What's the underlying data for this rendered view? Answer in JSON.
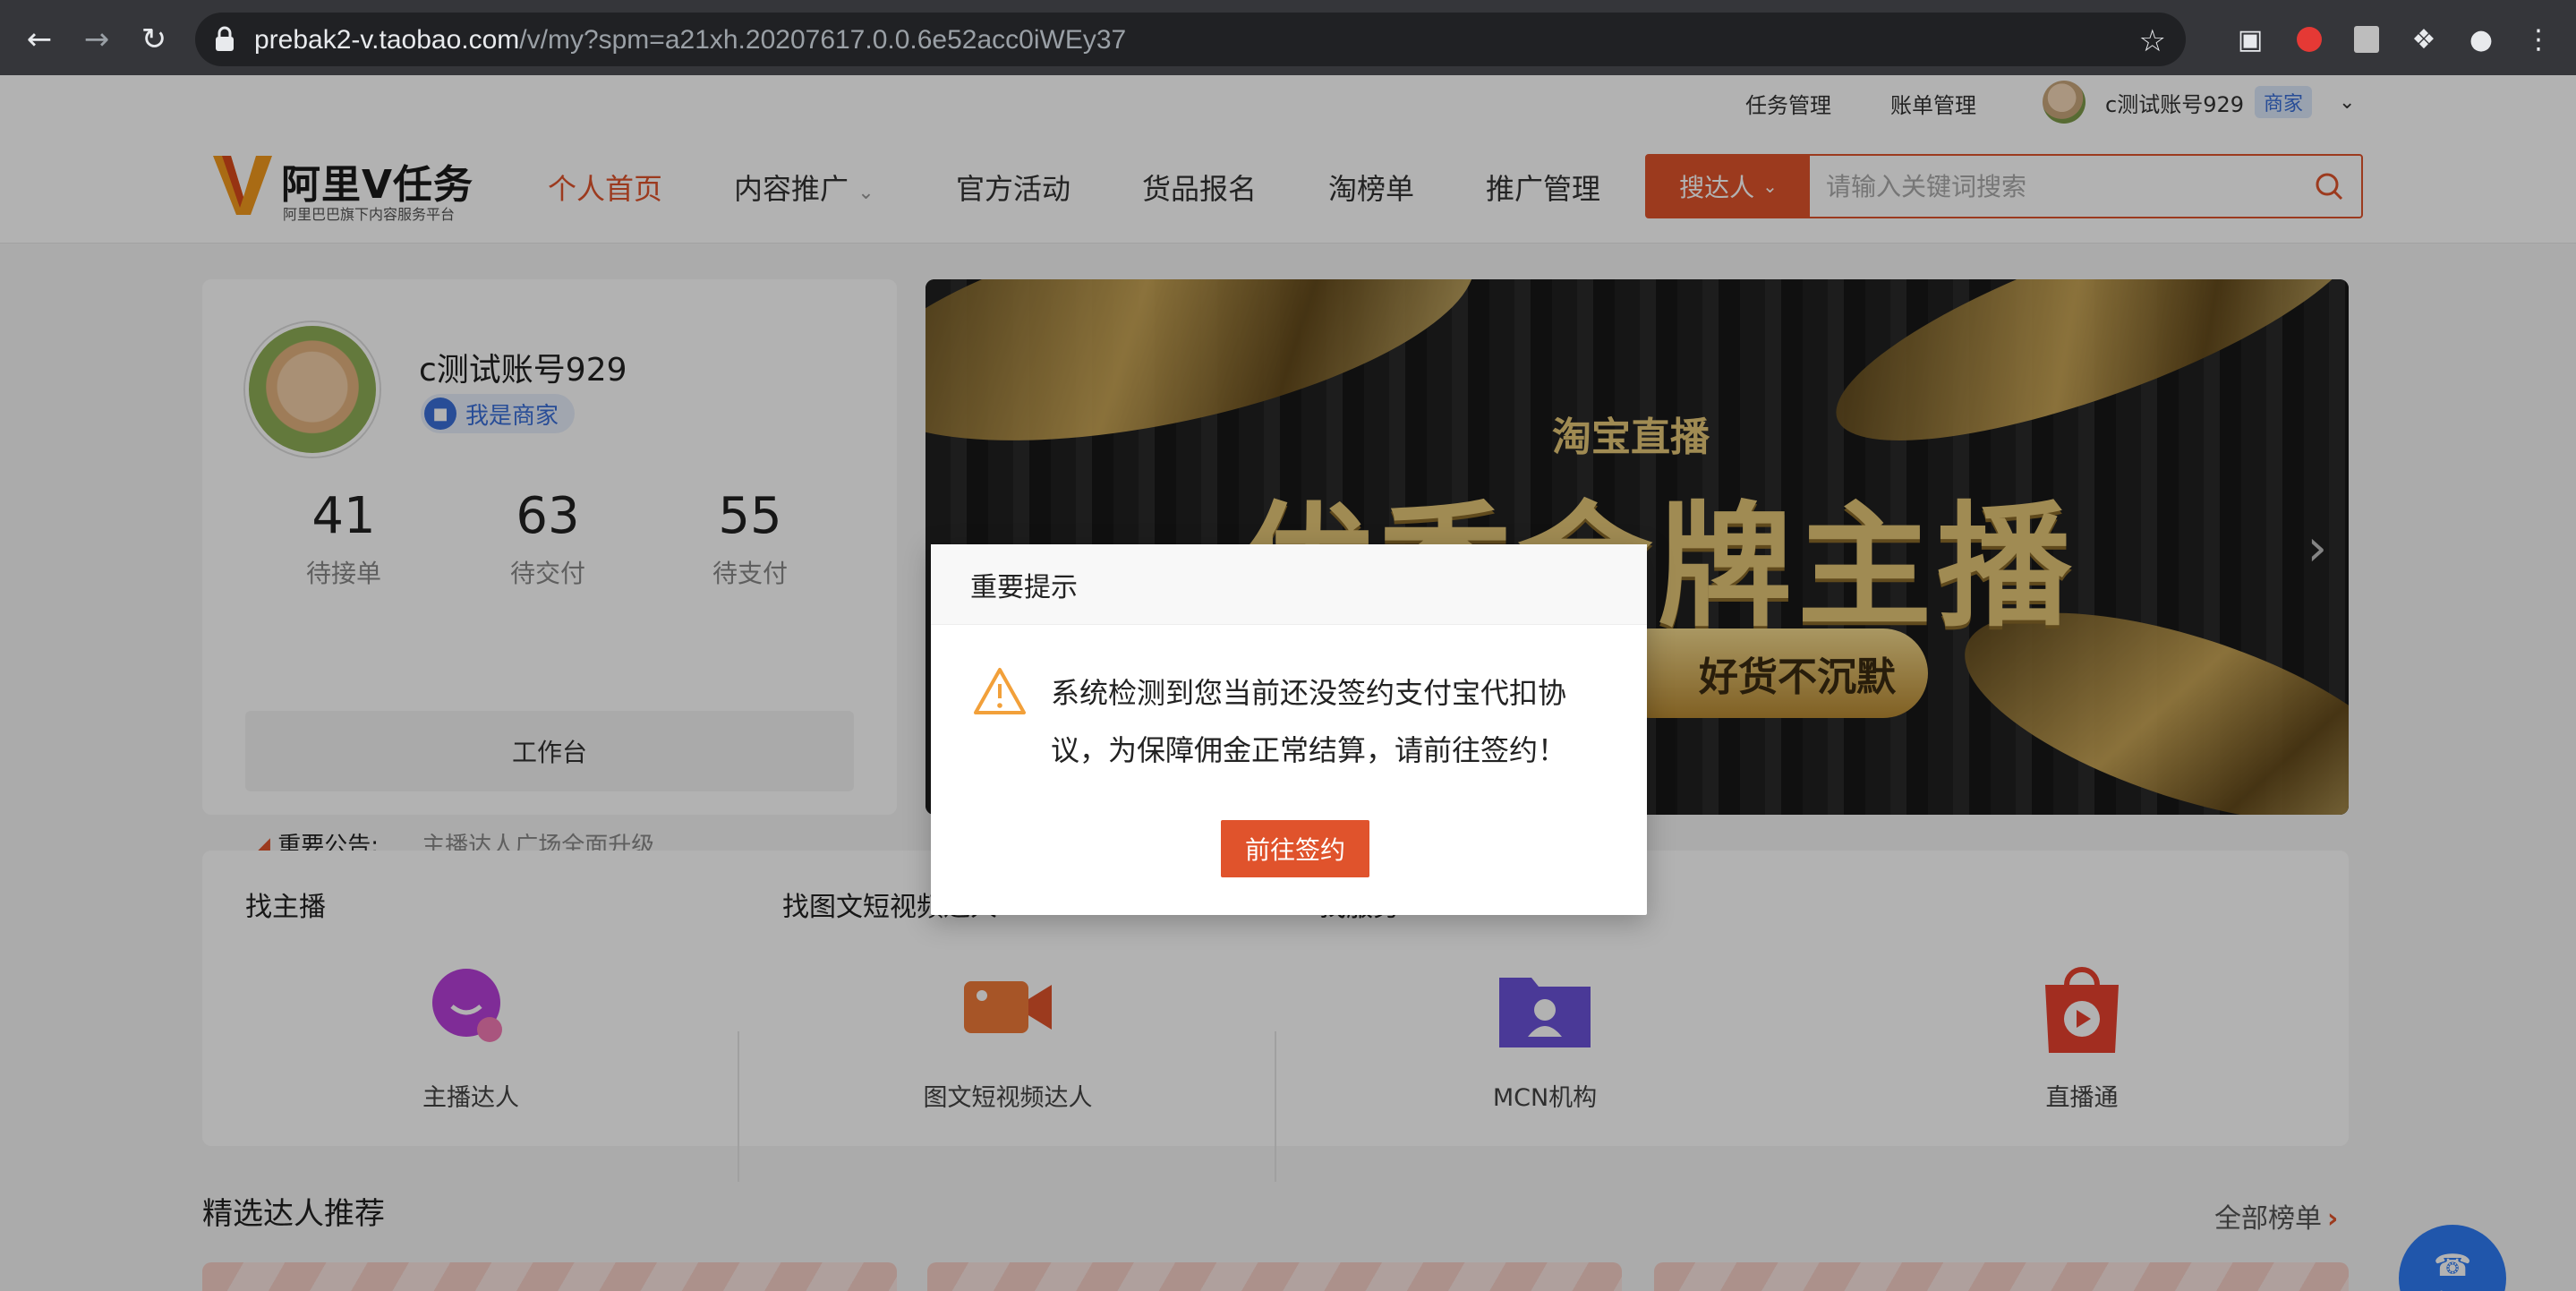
{
  "browser": {
    "url_host": "prebak2-v.taobao.com",
    "url_path": "/v/my?spm=a21xh.20207617.0.0.6e52acc0iWEy37"
  },
  "topbar": {
    "links": [
      "任务管理",
      "账单管理"
    ],
    "user_name": "c测试账号929",
    "user_badge": "商家"
  },
  "logo": {
    "title": "阿里V任务",
    "subtitle": "阿里巴巴旗下内容服务平台"
  },
  "nav": [
    {
      "label": "个人首页",
      "active": true
    },
    {
      "label": "内容推广"
    },
    {
      "label": "官方活动"
    },
    {
      "label": "货品报名"
    },
    {
      "label": "淘榜单"
    },
    {
      "label": "推广管理"
    }
  ],
  "search": {
    "select_label": "搜达人",
    "placeholder": "请输入关键词搜索"
  },
  "profile": {
    "name": "c测试账号929",
    "badge": "我是商家",
    "stats": [
      {
        "value": "41",
        "label": "待接单"
      },
      {
        "value": "63",
        "label": "待交付"
      },
      {
        "value": "55",
        "label": "待支付"
      }
    ],
    "workbench": "工作台",
    "notice_label": "重要公告:",
    "notice_text": "主播达人广场全面升级"
  },
  "banner": {
    "brand": "淘宝直播",
    "headline": "优秀金牌主播",
    "pill": "好货不沉默"
  },
  "services": {
    "sections": [
      "找主播",
      "找图文短视频达人",
      "找服务"
    ],
    "items": [
      "主播达人",
      "图文短视频达人",
      "MCN机构",
      "直播通"
    ]
  },
  "recommend": {
    "title": "精选达人推荐",
    "more": "全部榜单"
  },
  "service_bubble": "客服",
  "modal": {
    "title": "重要提示",
    "message": "系统检测到您当前还没签约支付宝代扣协议，为保障佣金正常结算，请前往签约！",
    "button": "前往签约"
  },
  "colors": {
    "brand": "#e0532c",
    "badge_blue": "#3a6fd8",
    "chrome_bg": "#35363a"
  }
}
